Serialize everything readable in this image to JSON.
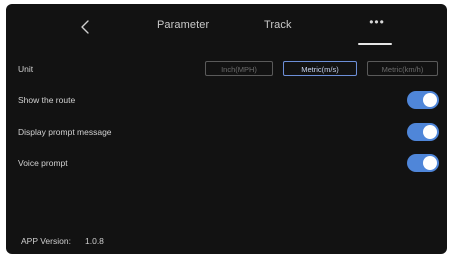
{
  "header": {
    "tabs": [
      {
        "label": "Parameter"
      },
      {
        "label": "Track"
      },
      {
        "label": "•••"
      }
    ],
    "back_icon": "chevron-left-icon"
  },
  "settings": {
    "unit": {
      "label": "Unit",
      "options": [
        "Inch(MPH)",
        "Metric(m/s)",
        "Metric(km/h)"
      ],
      "selected": "Metric(m/s)"
    },
    "show_route": {
      "label": "Show the route",
      "enabled": true
    },
    "display_prompt": {
      "label": "Display prompt message",
      "enabled": true
    },
    "voice_prompt": {
      "label": "Voice prompt",
      "enabled": true
    }
  },
  "footer": {
    "version_label": "APP Version:",
    "version_value": "1.0.8"
  },
  "colors": {
    "background": "#121212",
    "accent": "#4f86d9",
    "selected_border": "#6d8fd8"
  }
}
